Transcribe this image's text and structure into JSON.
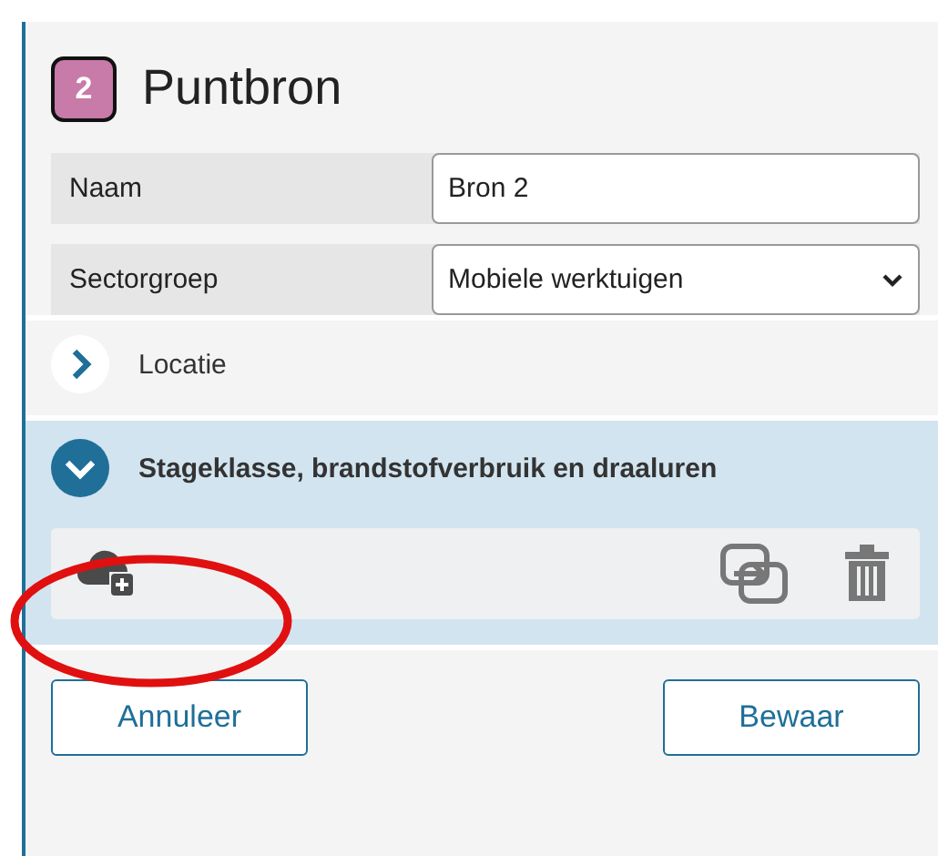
{
  "header": {
    "badge": "2",
    "title": "Puntbron"
  },
  "fields": [
    {
      "kind": "text",
      "label": "Naam",
      "value": "Bron 2"
    },
    {
      "kind": "select",
      "label": "Sectorgroep",
      "value": "Mobiele werktuigen"
    }
  ],
  "sections": [
    {
      "title": "Locatie",
      "expanded": false
    },
    {
      "title": "Stageklasse, brandstofverbruik en draaluren",
      "expanded": true
    }
  ],
  "buttons": [
    "Annuleer",
    "Bewaar"
  ]
}
